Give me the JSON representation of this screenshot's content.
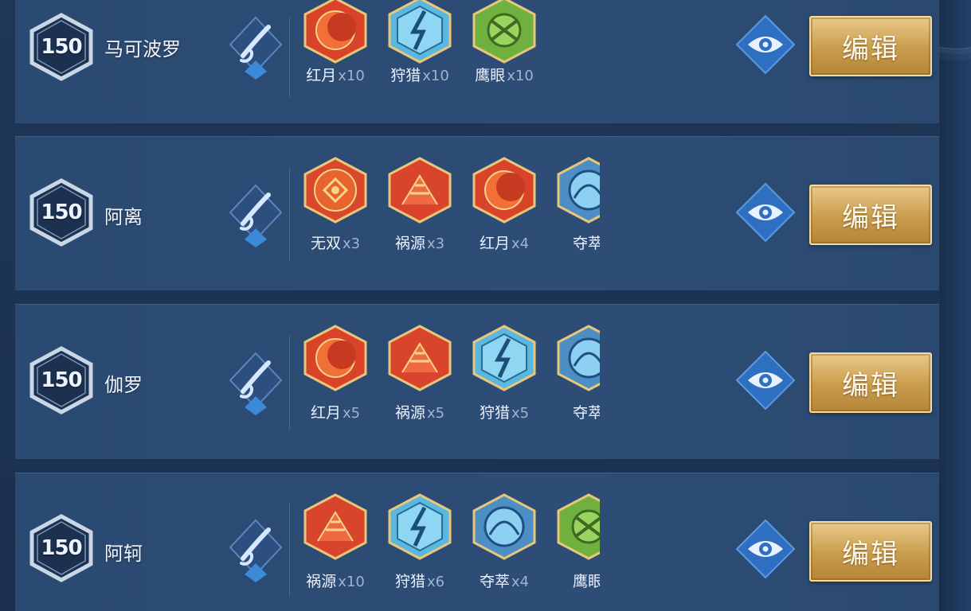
{
  "rows": [
    {
      "level": "150",
      "hero": "马可波罗",
      "runes": [
        {
          "name": "红月",
          "count": "x10",
          "icon": "red-moon-rune-icon"
        },
        {
          "name": "狩猎",
          "count": "x10",
          "icon": "hunt-rune-icon"
        },
        {
          "name": "鹰眼",
          "count": "x10",
          "icon": "hawk-eye-rune-icon"
        }
      ],
      "edit_label": "编辑"
    },
    {
      "level": "150",
      "hero": "阿离",
      "runes": [
        {
          "name": "无双",
          "count": "x3",
          "icon": "peerless-rune-icon"
        },
        {
          "name": "祸源",
          "count": "x3",
          "icon": "calamity-rune-icon"
        },
        {
          "name": "红月",
          "count": "x4",
          "icon": "red-moon-rune-icon"
        },
        {
          "name": "夺萃",
          "count": "",
          "icon": "plunder-rune-icon"
        }
      ],
      "edit_label": "编辑"
    },
    {
      "level": "150",
      "hero": "伽罗",
      "runes": [
        {
          "name": "红月",
          "count": "x5",
          "icon": "red-moon-rune-icon"
        },
        {
          "name": "祸源",
          "count": "x5",
          "icon": "calamity-rune-icon"
        },
        {
          "name": "狩猎",
          "count": "x5",
          "icon": "hunt-rune-icon"
        },
        {
          "name": "夺萃",
          "count": "",
          "icon": "plunder-rune-icon"
        }
      ],
      "edit_label": "编辑"
    },
    {
      "level": "150",
      "hero": "阿轲",
      "runes": [
        {
          "name": "祸源",
          "count": "x10",
          "icon": "calamity-rune-icon"
        },
        {
          "name": "狩猎",
          "count": "x6",
          "icon": "hunt-rune-icon"
        },
        {
          "name": "夺萃",
          "count": "x4",
          "icon": "plunder-rune-icon"
        },
        {
          "name": "鹰眼",
          "count": "",
          "icon": "hawk-eye-rune-icon"
        }
      ],
      "edit_label": "编辑"
    }
  ],
  "colors": {
    "red_rune": "#e2532a",
    "blue_rune": "#7ed0ee",
    "green_rune": "#7ec24a",
    "gold_frame": "#d9b35f",
    "edit_button": "#d6ad62"
  }
}
